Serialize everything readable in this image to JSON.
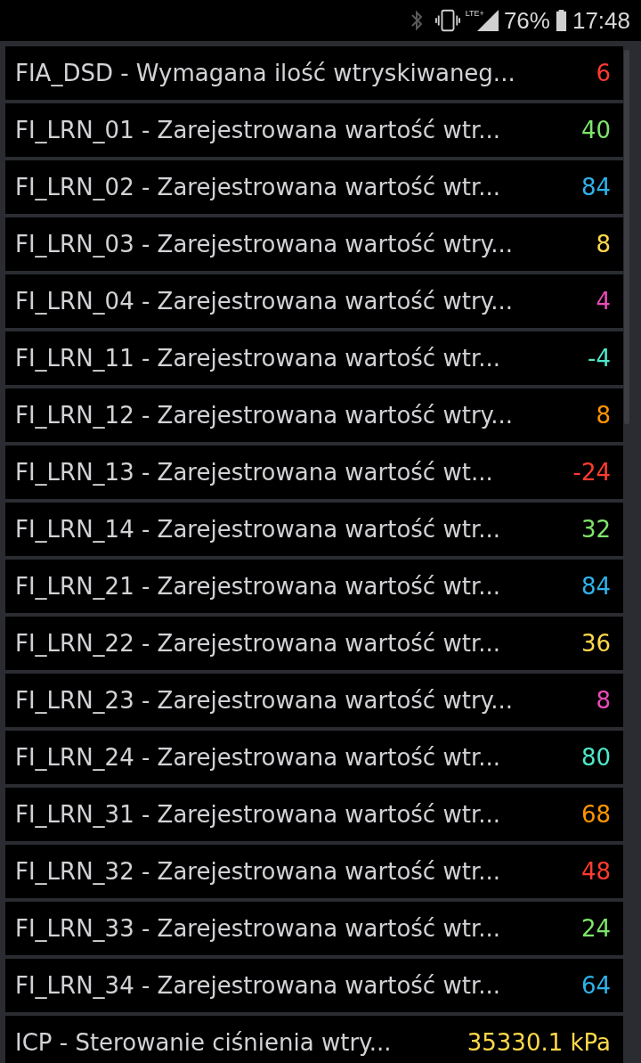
{
  "status_bar": {
    "battery": "76%",
    "time": "17:48",
    "network": "LTE+"
  },
  "items": [
    {
      "label": "FIA_DSD - Wymagana ilość wtryskiwaneg...",
      "value": "6",
      "color": "#ff3b30"
    },
    {
      "label": "FI_LRN_01 - Zarejestrowana wartość wtr...",
      "value": "40",
      "color": "#7ee56a"
    },
    {
      "label": "FI_LRN_02 - Zarejestrowana wartość wtr...",
      "value": "84",
      "color": "#2fb2ea"
    },
    {
      "label": "FI_LRN_03 - Zarejestrowana wartość wtry...",
      "value": "8",
      "color": "#ffd84a"
    },
    {
      "label": "FI_LRN_04 - Zarejestrowana wartość wtry...",
      "value": "4",
      "color": "#e84bb8"
    },
    {
      "label": "FI_LRN_11 - Zarejestrowana wartość wtr...",
      "value": "-4",
      "color": "#4de8c8"
    },
    {
      "label": "FI_LRN_12 - Zarejestrowana wartość wtry...",
      "value": "8",
      "color": "#ff9500"
    },
    {
      "label": "FI_LRN_13 - Zarejestrowana wartość wt...",
      "value": "-24",
      "color": "#ff3b30"
    },
    {
      "label": "FI_LRN_14 - Zarejestrowana wartość wtr...",
      "value": "32",
      "color": "#7ee56a"
    },
    {
      "label": "FI_LRN_21 - Zarejestrowana wartość wtr...",
      "value": "84",
      "color": "#2fb2ea"
    },
    {
      "label": "FI_LRN_22 - Zarejestrowana wartość wtr...",
      "value": "36",
      "color": "#ffd84a"
    },
    {
      "label": "FI_LRN_23 - Zarejestrowana wartość wtry...",
      "value": "8",
      "color": "#e84bb8"
    },
    {
      "label": "FI_LRN_24 - Zarejestrowana wartość wtr...",
      "value": "80",
      "color": "#4de8c8"
    },
    {
      "label": "FI_LRN_31 - Zarejestrowana wartość wtr...",
      "value": "68",
      "color": "#ff9500"
    },
    {
      "label": "FI_LRN_32 - Zarejestrowana wartość wtr...",
      "value": "48",
      "color": "#ff3b30"
    },
    {
      "label": "FI_LRN_33 - Zarejestrowana wartość wtr...",
      "value": "24",
      "color": "#7ee56a"
    },
    {
      "label": "FI_LRN_34 - Zarejestrowana wartość wtr...",
      "value": "64",
      "color": "#2fb2ea"
    },
    {
      "label": "ICP - Sterowanie ciśnienia wtry...",
      "value": "35330.1 kPa",
      "color": "#ffd84a"
    }
  ]
}
